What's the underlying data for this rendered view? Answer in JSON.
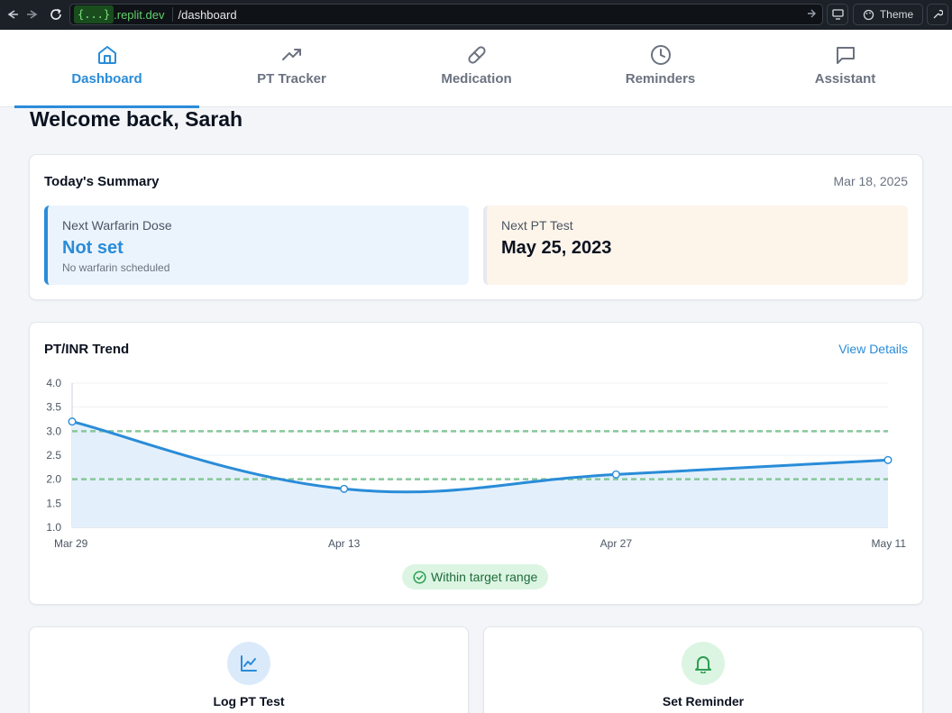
{
  "browser": {
    "host_badge": "{...}",
    "domain": ".replit.dev",
    "path": "/dashboard",
    "theme_label": "Theme"
  },
  "nav": {
    "tabs": [
      {
        "label": "Dashboard",
        "icon": "home-icon",
        "active": true
      },
      {
        "label": "PT Tracker",
        "icon": "trending-up-icon",
        "active": false
      },
      {
        "label": "Medication",
        "icon": "pill-icon",
        "active": false
      },
      {
        "label": "Reminders",
        "icon": "clock-icon",
        "active": false
      },
      {
        "label": "Assistant",
        "icon": "message-icon",
        "active": false
      }
    ]
  },
  "welcome": "Welcome back, Sarah",
  "summary": {
    "title": "Today's Summary",
    "date": "Mar 18, 2025",
    "next_dose": {
      "label": "Next Warfarin Dose",
      "value": "Not set",
      "note": "No warfarin scheduled"
    },
    "next_test": {
      "label": "Next PT Test",
      "value": "May 25, 2023"
    }
  },
  "trend": {
    "title": "PT/INR Trend",
    "link": "View Details",
    "status": "Within target range"
  },
  "chart_data": {
    "type": "line",
    "title": "PT/INR Trend",
    "x": [
      "Mar 29",
      "Apr 13",
      "Apr 27",
      "May 11"
    ],
    "series": [
      {
        "values": [
          3.2,
          1.8,
          2.1,
          2.4
        ]
      }
    ],
    "target_range": [
      2.0,
      3.0
    ],
    "ylim": [
      1.0,
      4.0
    ],
    "yticks": [
      "1.0",
      "1.5",
      "2.0",
      "2.5",
      "3.0",
      "3.5",
      "4.0"
    ],
    "grid": true,
    "colors": {
      "line": "#2a8cd8",
      "fill": "#e3f0fb",
      "target": "#86c79a"
    }
  },
  "actions": [
    {
      "label": "Log PT Test",
      "icon": "chart-icon"
    },
    {
      "label": "Set Reminder",
      "icon": "bell-icon"
    }
  ],
  "colors": {
    "accent": "#2a8cd8",
    "success": "#2e9e52"
  }
}
